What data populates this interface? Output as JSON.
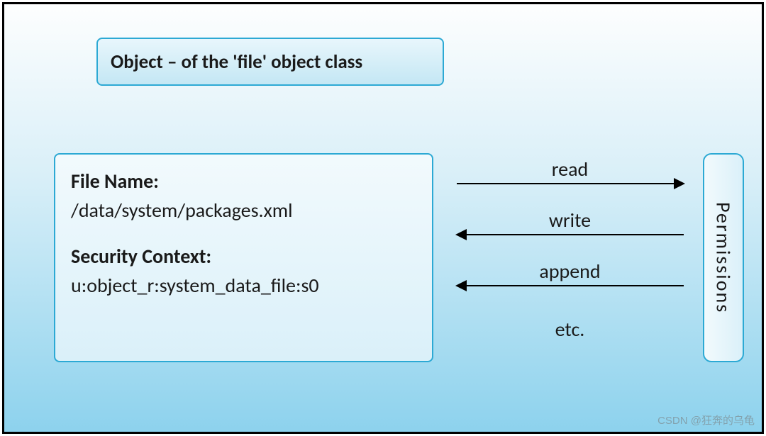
{
  "title": "Object – of the 'file' object class",
  "file": {
    "name_label": "File Name:",
    "name_value": "/data/system/packages.xml",
    "context_label": "Security Context:",
    "context_value": "u:object_r:system_data_file:s0"
  },
  "permissions": {
    "label": "Permissions",
    "items": [
      "read",
      "write",
      "append"
    ],
    "etc": "etc."
  },
  "arrow_directions": [
    "right",
    "left",
    "left"
  ],
  "watermark": "CSDN @狂奔的乌龟"
}
